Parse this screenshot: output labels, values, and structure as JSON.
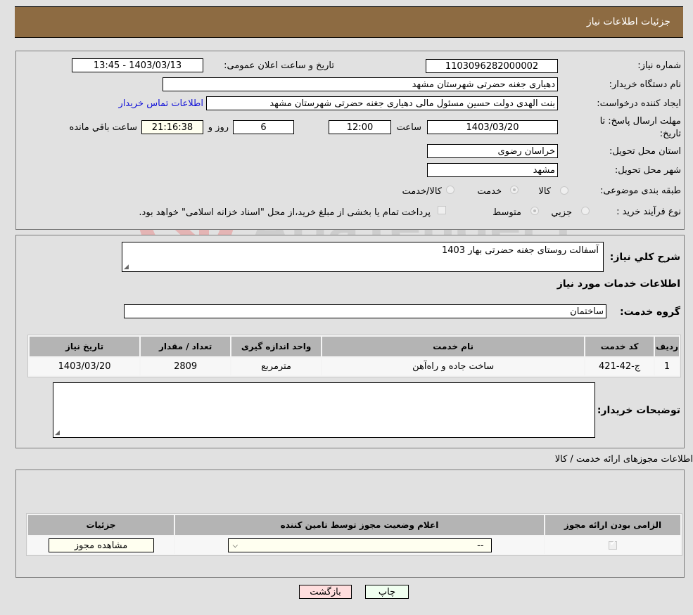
{
  "header": {
    "title": "جزئیات اطلاعات نیاز"
  },
  "info": {
    "need_number_label": "شماره نیاز:",
    "need_number": "1103096282000002",
    "announce_label": "تاریخ و ساعت اعلان عمومی:",
    "announce_value": "1403/03/13 - 13:45",
    "buyer_org_label": "نام دستگاه خریدار:",
    "buyer_org": "دهیاری جغنه حضرتی  شهرستان مشهد",
    "requester_label": "ایجاد کننده درخواست:",
    "requester": "بنت الهدی دولت حسین مسئول مالی  دهیاری جغنه حضرتی  شهرستان مشهد",
    "contact_link": "اطلاعات تماس خریدار",
    "deadline_label_1": "مهلت ارسال پاسخ: تا",
    "deadline_label_2": "تاریخ:",
    "deadline_date": "1403/03/20",
    "time_label": "ساعت",
    "deadline_time": "12:00",
    "days": "6",
    "days_label": "روز و",
    "remaining_time": "21:16:38",
    "remaining_label": "ساعت باقي مانده",
    "province_label": "استان محل تحویل:",
    "province": "خراسان رضوی",
    "city_label": "شهر محل تحویل:",
    "city": "مشهد",
    "category_label": "طبقه بندی موضوعی:",
    "category_options": [
      {
        "label": "کالا",
        "checked": false
      },
      {
        "label": "خدمت",
        "checked": true
      },
      {
        "label": "کالا/خدمت",
        "checked": false
      }
    ],
    "process_label": "نوع فرآیند خرید :",
    "process_options": [
      {
        "label": "جزيي",
        "checked": false
      },
      {
        "label": "متوسط",
        "checked": true
      }
    ],
    "treasury_note": "پرداخت تمام یا بخشی از مبلغ خرید،از محل \"اسناد خزانه اسلامی\" خواهد بود."
  },
  "details": {
    "summary_label": "شرح کلي نياز:",
    "summary": "آسفالت روستای جغنه حضرتی بهار 1403",
    "services_heading": "اطلاعات خدمات مورد نیاز",
    "service_group_label": "گروه خدمت:",
    "service_group": "ساختمان",
    "table": {
      "headers": [
        "ردیف",
        "کد خدمت",
        "نام خدمت",
        "واحد اندازه گیری",
        "تعداد / مقدار",
        "تاریخ نیاز"
      ],
      "rows": [
        [
          "1",
          "ج-42-421",
          "ساخت جاده و راه‌آهن",
          "مترمربع",
          "2809",
          "1403/03/20"
        ]
      ]
    },
    "buyer_notes_label": "توضیحات خریدار:",
    "buyer_notes": ""
  },
  "licenses": {
    "heading": "اطلاعات مجوزهای ارائه خدمت / کالا",
    "headers": [
      "الزامی بودن ارائه مجوز",
      "اعلام وضعیت مجوز توسط تامین کننده",
      "جزئیات"
    ],
    "row": {
      "required": true,
      "status": "--",
      "details_button": "مشاهده مجوز"
    }
  },
  "actions": {
    "print": "چاپ",
    "back": "بازگشت"
  },
  "watermark": {
    "text": "AriaTender.neT"
  },
  "colors": {
    "header": "#8d6b42",
    "link": "#1010d8",
    "print_bg": "#f0fff0",
    "back_bg": "#ffdede"
  }
}
